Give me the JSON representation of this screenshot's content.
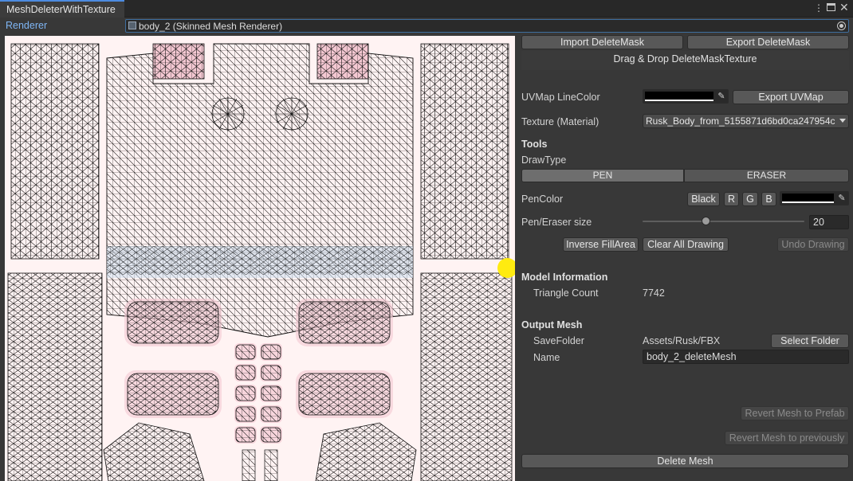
{
  "window": {
    "tab_title": "MeshDeleterWithTexture",
    "menu_icon": "kebab-icon",
    "maximize_icon": "maximize-icon",
    "close_icon": "close-icon"
  },
  "renderer": {
    "label": "Renderer",
    "value": "body_2 (Skinned Mesh Renderer)"
  },
  "mask": {
    "import_label": "Import DeleteMask",
    "export_label": "Export DeleteMask",
    "dropzone_label": "Drag & Drop DeleteMaskTexture"
  },
  "uvmap": {
    "line_color_label": "UVMap LineColor",
    "line_color": "#000000",
    "export_label": "Export UVMap"
  },
  "texture": {
    "label": "Texture (Material)",
    "selected": "Rusk_Body_from_5155871d6bd0ca247954c"
  },
  "tools": {
    "heading": "Tools",
    "draw_type_label": "DrawType",
    "draw_types": [
      "PEN",
      "ERASER"
    ],
    "selected_draw_type": "PEN",
    "pen_color_label": "PenColor",
    "color_presets": [
      "Black",
      "R",
      "G",
      "B"
    ],
    "pen_color": "#000000",
    "size_label": "Pen/Eraser size",
    "size_value": "20",
    "size_min": 1,
    "size_max": 50,
    "inverse_label": "Inverse FillArea",
    "clear_label": "Clear All Drawing",
    "undo_label": "Undo Drawing"
  },
  "model_info": {
    "heading": "Model Information",
    "triangle_label": "Triangle Count",
    "triangle_value": "7742"
  },
  "output": {
    "heading": "Output Mesh",
    "folder_label": "SaveFolder",
    "folder_value": "Assets/Rusk/FBX",
    "select_folder_label": "Select Folder",
    "name_label": "Name",
    "name_value": "body_2_deleteMesh"
  },
  "actions": {
    "revert_prefab_label": "Revert Mesh to Prefab",
    "revert_previous_label": "Revert Mesh to previously",
    "delete_label": "Delete Mesh"
  },
  "colors": {
    "accent": "#4c8be0",
    "canvas_bg": "#fff3f3",
    "pen_cursor": "#ffeb10",
    "mask_blue": "#cfe0f0",
    "mask_pink": "#f4c8d2"
  }
}
